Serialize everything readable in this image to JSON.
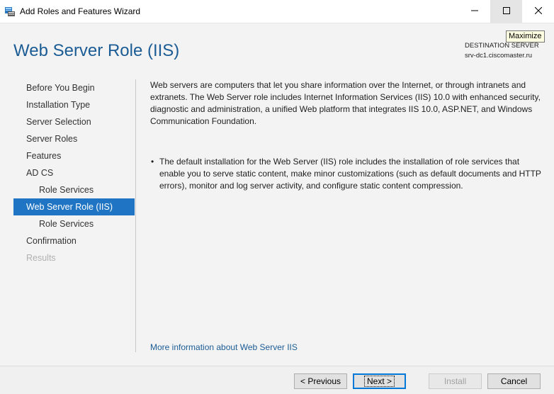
{
  "window": {
    "title": "Add Roles and Features Wizard",
    "tooltip": "Maximize"
  },
  "page": {
    "title": "Web Server Role (IIS)",
    "destination_label": "DESTINATION SERVER",
    "destination_server": "srv-dc1.ciscomaster.ru"
  },
  "nav": {
    "items": [
      {
        "label": "Before You Begin",
        "state": "normal",
        "level": 0
      },
      {
        "label": "Installation Type",
        "state": "normal",
        "level": 0
      },
      {
        "label": "Server Selection",
        "state": "normal",
        "level": 0
      },
      {
        "label": "Server Roles",
        "state": "normal",
        "level": 0
      },
      {
        "label": "Features",
        "state": "normal",
        "level": 0
      },
      {
        "label": "AD CS",
        "state": "normal",
        "level": 0
      },
      {
        "label": "Role Services",
        "state": "normal",
        "level": 1
      },
      {
        "label": "Web Server Role (IIS)",
        "state": "active",
        "level": 0
      },
      {
        "label": "Role Services",
        "state": "normal",
        "level": 1
      },
      {
        "label": "Confirmation",
        "state": "normal",
        "level": 0
      },
      {
        "label": "Results",
        "state": "disabled",
        "level": 0
      }
    ]
  },
  "content": {
    "description": "Web servers are computers that let you share information over the Internet, or through intranets and extranets. The Web Server role includes Internet Information Services (IIS) 10.0 with enhanced security, diagnostic and administration, a unified Web platform that integrates IIS 10.0, ASP.NET, and Windows Communication Foundation.",
    "bullet": "The default installation for the Web Server (IIS) role includes the installation of role services that enable you to serve static content, make minor customizations (such as default documents and HTTP errors), monitor and log server activity, and configure static content compression.",
    "more_link": "More information about Web Server IIS"
  },
  "buttons": {
    "previous": "< Previous",
    "next": "Next >",
    "install": "Install",
    "cancel": "Cancel"
  },
  "colors": {
    "accent": "#1f75c4",
    "title": "#1c5c95"
  }
}
